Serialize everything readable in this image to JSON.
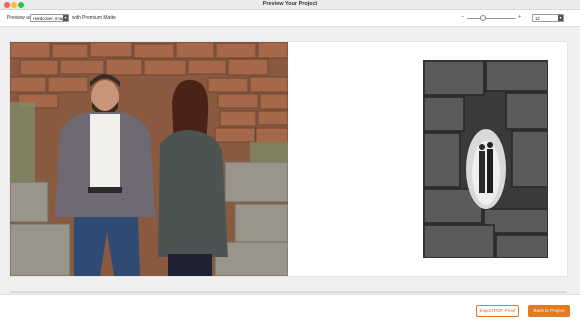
{
  "window": {
    "title": "Preview Your Project"
  },
  "toolbar": {
    "preview_as_label": "Preview as",
    "preview_as_value": "Hardcover, Image",
    "with_label": "with",
    "matte_value": "Premium Matte",
    "zoom_value": "12"
  },
  "footer": {
    "export_label": "Export PDF Proof",
    "back_label": "Back to Project"
  },
  "colors": {
    "accent": "#e27a1f",
    "close": "#ff5f57",
    "minimize": "#febc2e",
    "maximize": "#28c840"
  },
  "icons": {
    "zoom_out": "minus-icon",
    "zoom_in": "plus-icon",
    "dropdown": "chevron-down-icon"
  }
}
